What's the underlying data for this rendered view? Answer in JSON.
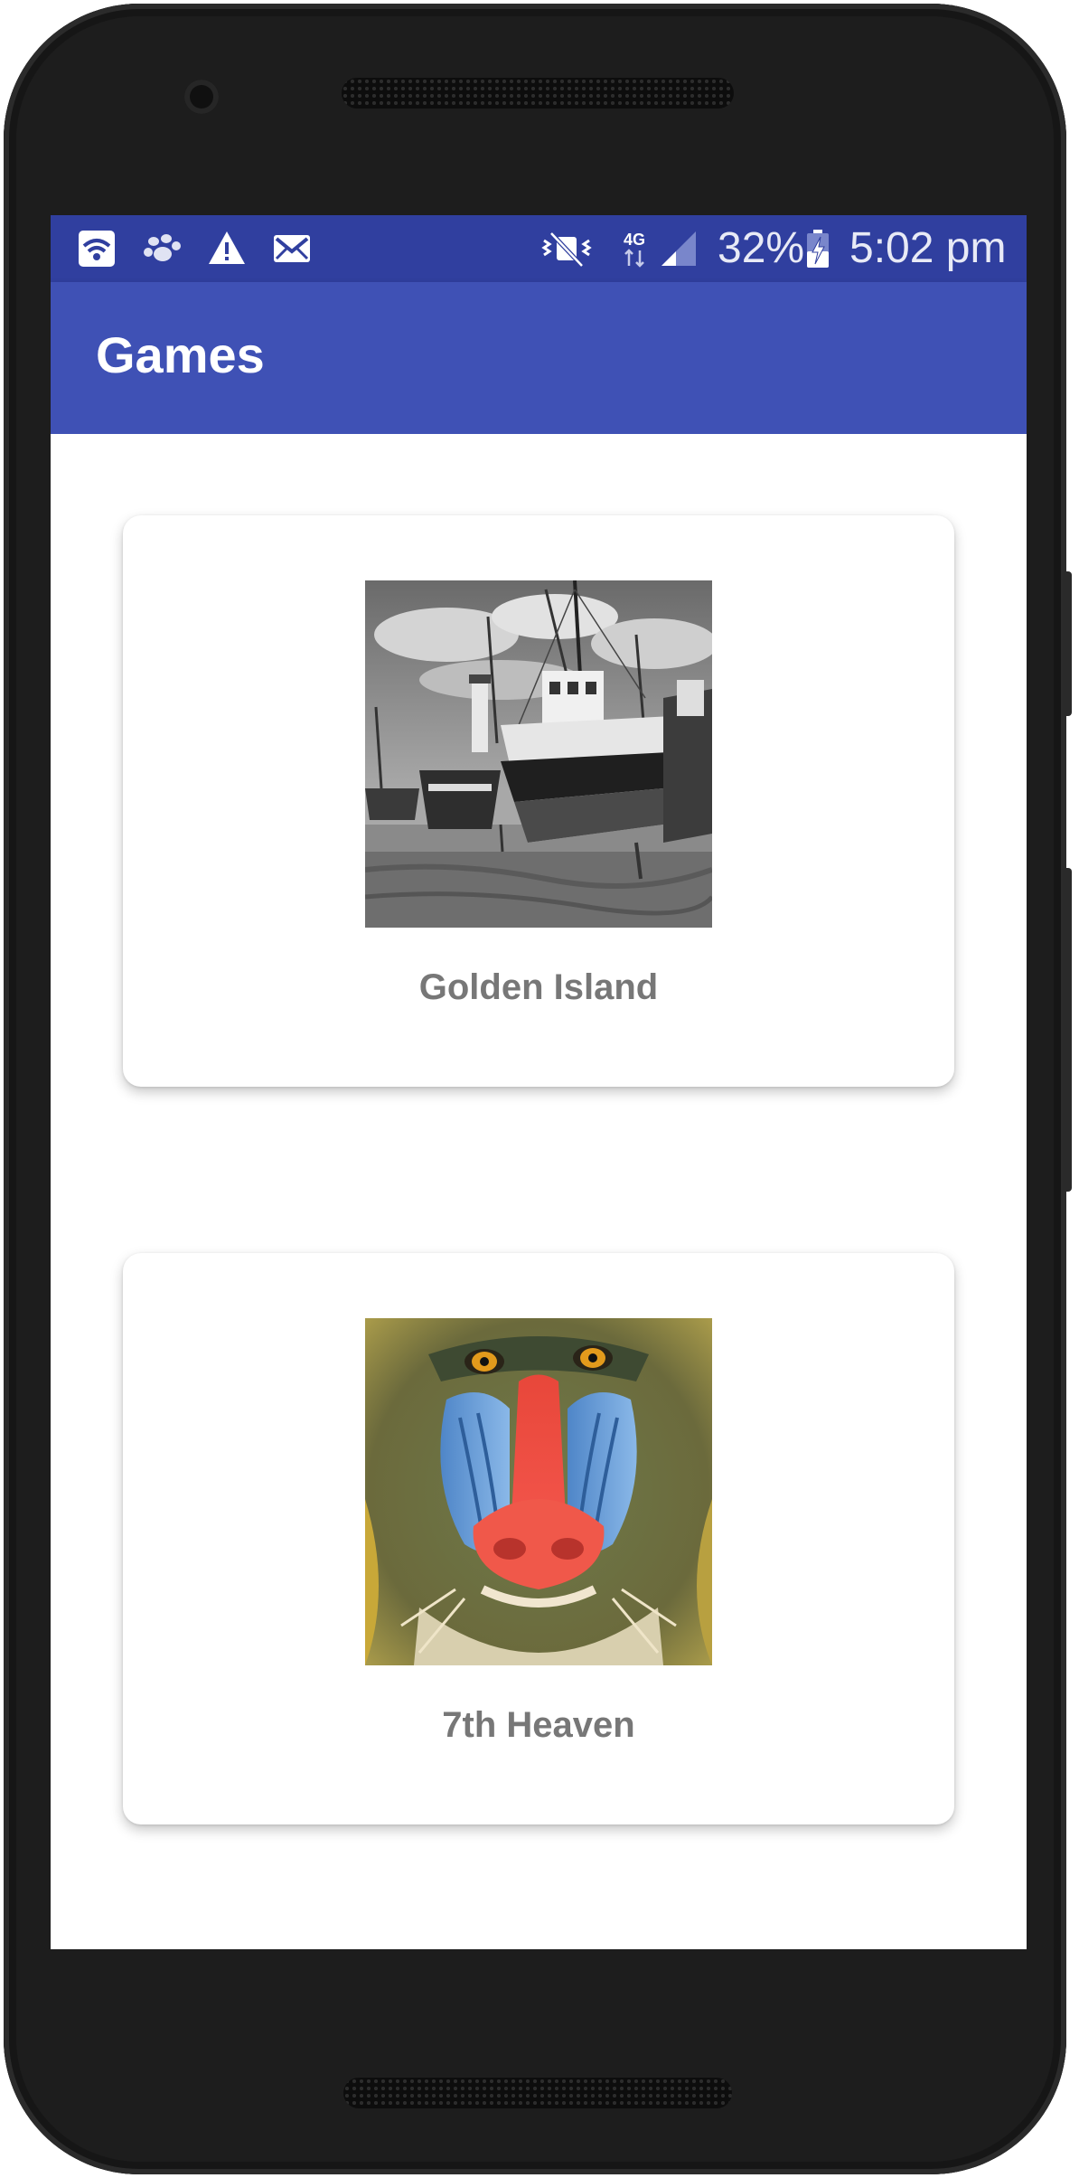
{
  "status_bar": {
    "battery": "32%",
    "time": "5:02 pm",
    "network": "4G",
    "icons_left": [
      "wifi-icon",
      "paw-icon",
      "warning-icon",
      "mail-icon"
    ],
    "icons_right": [
      "vibrate-icon",
      "network-4g-icon",
      "signal-icon",
      "battery-charging-icon"
    ]
  },
  "app_bar": {
    "title": "Games",
    "color": "#3f51b5",
    "status_color": "#303f9f"
  },
  "games": [
    {
      "title": "Golden Island",
      "image": "boats-grayscale-photo"
    },
    {
      "title": "7th Heaven",
      "image": "mandrill-face-photo"
    }
  ]
}
